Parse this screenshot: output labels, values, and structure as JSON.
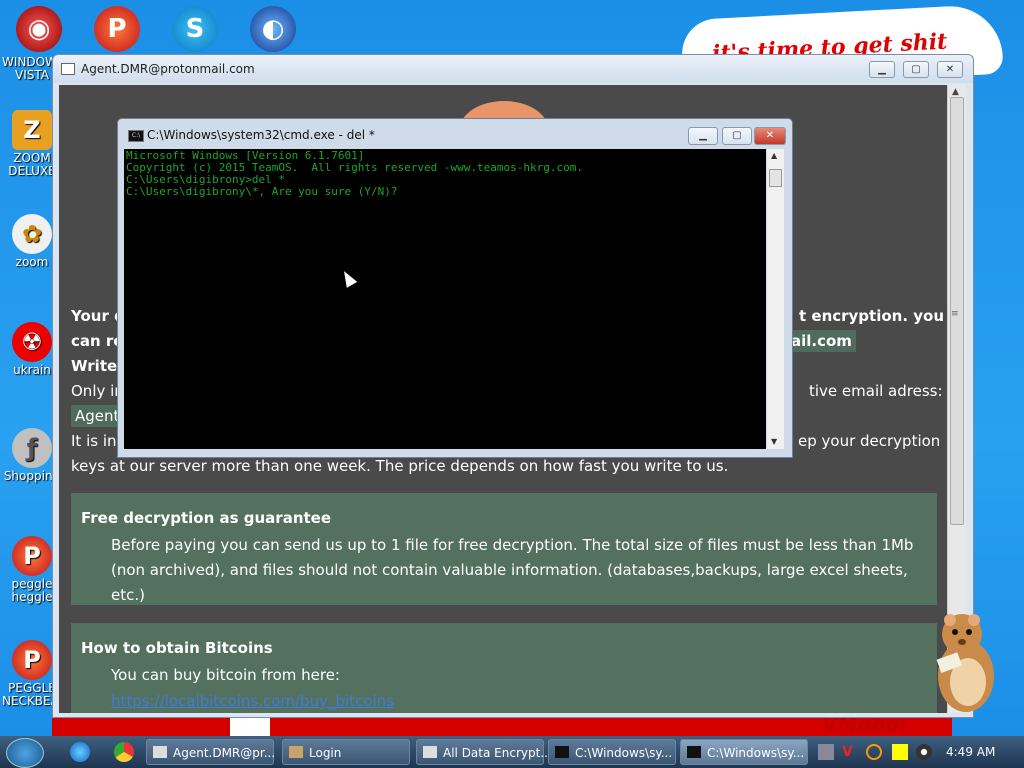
{
  "desktop": {
    "banner_text": "it's time to get shit",
    "watermark_text": "VMoboi",
    "icons": [
      {
        "label": "WINDOWS VISTA"
      },
      {
        "label": "ZOOM DELUXE"
      },
      {
        "label": "zoom"
      },
      {
        "label": "ukrain"
      },
      {
        "label": "Shopping"
      },
      {
        "label": "peggle heggle"
      },
      {
        "label": "PEGGLE NECKBEARD"
      }
    ]
  },
  "ransom_window": {
    "title": "Agent.DMR@protonmail.com",
    "lines": {
      "l1_left": "Your d",
      "l1_right": "t encryption. you",
      "l2_left": "can re",
      "l2_right": "ail.com",
      "l3_left": "Write",
      "l4_left": "Only in",
      "l4_right": "tive email adress:",
      "l5_left": "Agent.",
      "l6_left": "It is in",
      "l6_right": "ep your decryption",
      "l7": "keys at our server more than one week. The price depends on how fast you write to us."
    },
    "free_decryption": {
      "heading": "Free decryption as guarantee",
      "body": "Before paying you can send us up to 1 file for free decryption. The total size of files must be less than 1Mb (non archived), and files should not contain valuable information. (databases,backups, large excel sheets, etc.)"
    },
    "bitcoins": {
      "heading": "How to obtain Bitcoins",
      "body": "You can buy bitcoin from here:",
      "link": "https://localbitcoins.com/buy_bitcoins"
    }
  },
  "cmd_window": {
    "title": "C:\\Windows\\system32\\cmd.exe - del  *",
    "icon_text": "C:\\",
    "console": [
      "Microsoft Windows [Version 6.1.7601]",
      "Copyright (c) 2015 TeamOS.  All rights reserved -www.teamos-hkrg.com.",
      "",
      "C:\\Users\\digibrony>del *",
      "C:\\Users\\digibrony\\*, Are you sure (Y/N)?"
    ]
  },
  "taskbar": {
    "tasks": [
      {
        "label": "Agent.DMR@pr..."
      },
      {
        "label": "Login"
      },
      {
        "label": "All Data Encrypt..."
      },
      {
        "label": "C:\\Windows\\sy..."
      },
      {
        "label": "C:\\Windows\\sy..."
      }
    ],
    "clock": "4:49 AM"
  },
  "colors": {
    "console_text": "#1fa52a",
    "panel_green": "#54705f",
    "desktop_blue": "#1b8fe6"
  }
}
